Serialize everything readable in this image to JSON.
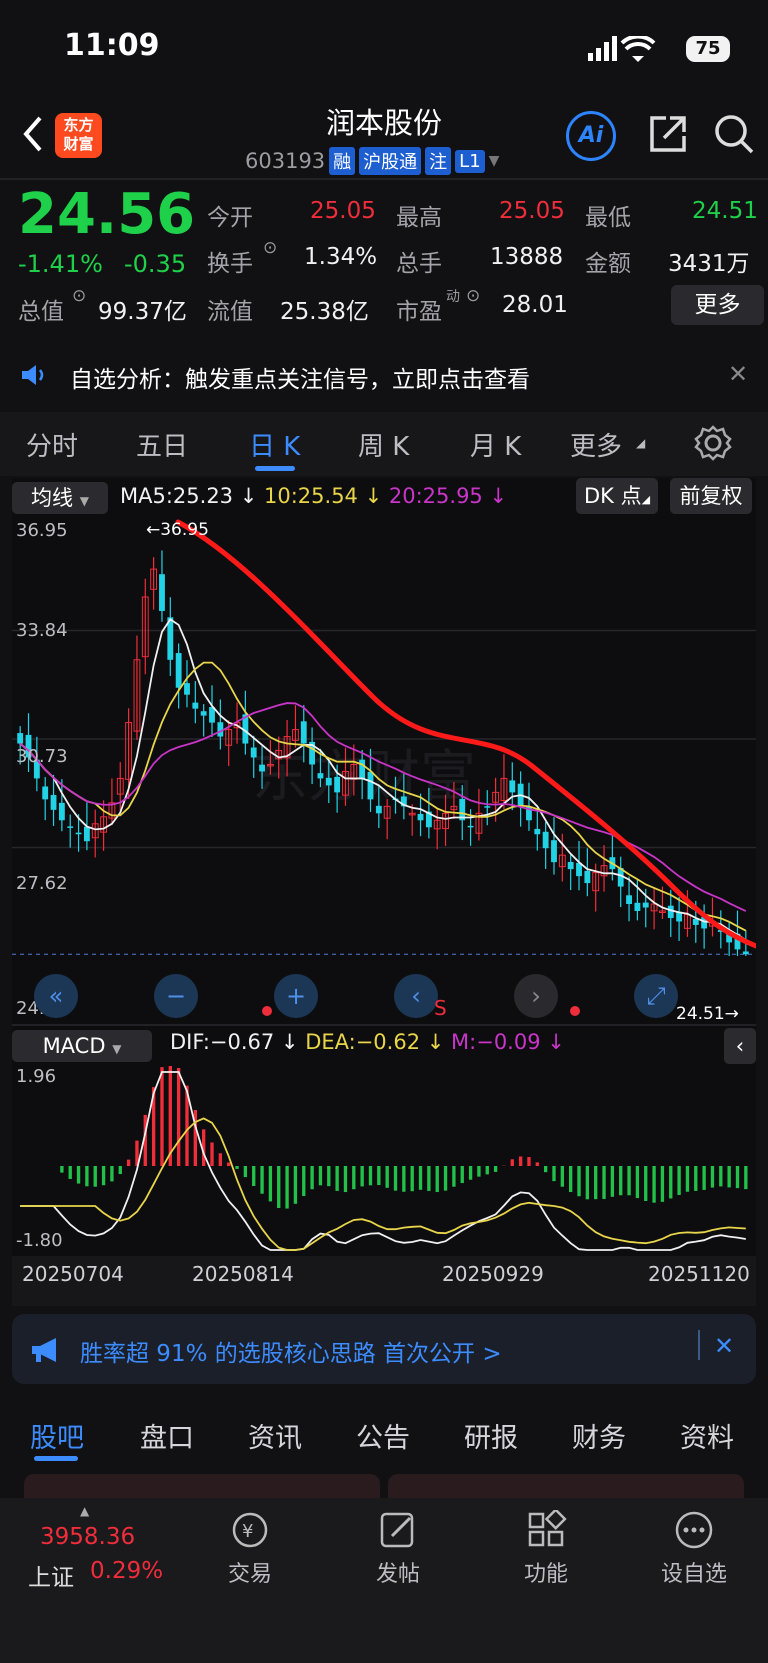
{
  "status": {
    "time": "11:09",
    "battery": "75"
  },
  "header": {
    "app_logo_top": "东方",
    "app_logo_bottom": "财富",
    "stock_name": "润本股份",
    "stock_code": "603193",
    "tags": [
      "融",
      "沪股通",
      "注",
      "L1"
    ],
    "ai_label": "Ai"
  },
  "quote": {
    "price": "24.56",
    "change_pct": "-1.41%",
    "change": "-0.35",
    "open_label": "今开",
    "open": "25.05",
    "high_label": "最高",
    "high": "25.05",
    "low_label": "最低",
    "low": "24.51",
    "turnover_label": "换手",
    "turnover": "1.34%",
    "volume_label": "总手",
    "volume": "13888",
    "amount_label": "金额",
    "amount": "3431万",
    "mcap_label": "总值",
    "mcap": "99.37亿",
    "float_label": "流值",
    "float": "25.38亿",
    "pe_label": "市盈",
    "pe_sup": "动",
    "pe": "28.01",
    "more_label": "更多"
  },
  "notice": {
    "text": "自选分析：触发重点关注信号，立即点击查看"
  },
  "period_tabs": [
    "分时",
    "五日",
    "日 K",
    "周 K",
    "月 K",
    "更多"
  ],
  "chart": {
    "indicator_select": "均线",
    "ma5": "MA5:25.23",
    "ma10": "10:25.54",
    "ma20": "20:25.95",
    "dk_label": "DK 点",
    "adjust_label": "前复权",
    "y_labels": [
      "36.95",
      "33.84",
      "30.73",
      "27.62",
      "24.51"
    ],
    "max_marker": "←36.95",
    "min_marker": "24.51→",
    "watermark": "东方财富",
    "s_marker": "S",
    "macd_select": "MACD",
    "dif": "DIF:−0.67",
    "dea": "DEA:−0.62",
    "m": "M:−0.09",
    "macd_y_top": "1.96",
    "macd_y_bottom": "-1.80",
    "dates": [
      "20250704",
      "20250814",
      "20250929",
      "20251120"
    ],
    "colors": {
      "up": "#f02d3a",
      "down": "#22d3e6",
      "ma5": "#f0f0f0",
      "ma10": "#e8d54a",
      "ma20": "#c935c8",
      "trend": "#ff1a1a"
    }
  },
  "ad": {
    "text": "胜率超 91% 的选股核心思路 首次公开 >"
  },
  "bottom_tabs": [
    "股吧",
    "盘口",
    "资讯",
    "公告",
    "研报",
    "财务",
    "资料"
  ],
  "bottom_bar": {
    "index_value": "3958.36",
    "index_name": "上证",
    "index_pct": "0.29%",
    "trade": "交易",
    "post": "发帖",
    "func": "功能",
    "watch": "设自选"
  },
  "chart_data": {
    "type": "candlestick",
    "ylim": [
      24.51,
      36.95
    ],
    "max": 36.95,
    "min": 24.51,
    "closes": [
      30.6,
      30.2,
      29.6,
      29.0,
      28.7,
      28.4,
      28.2,
      28.0,
      27.8,
      28.3,
      28.5,
      28.9,
      29.6,
      31.2,
      33.0,
      34.8,
      35.6,
      34.4,
      33.0,
      32.2,
      32.0,
      31.6,
      31.4,
      31.2,
      30.8,
      31.0,
      31.2,
      30.6,
      30.2,
      29.8,
      30.0,
      30.4,
      30.8,
      31.0,
      30.6,
      30.0,
      29.6,
      29.4,
      29.2,
      29.8,
      30.0,
      29.6,
      29.0,
      28.6,
      28.8,
      29.0,
      28.8,
      28.6,
      28.4,
      28.2,
      28.4,
      28.6,
      28.8,
      28.4,
      28.2,
      28.6,
      28.8,
      29.2,
      29.6,
      29.2,
      28.8,
      28.4,
      28.0,
      27.6,
      27.2,
      27.4,
      27.0,
      26.8,
      26.6,
      26.9,
      27.1,
      27.0,
      26.5,
      26.0,
      25.8,
      25.9,
      26.0,
      25.8,
      25.6,
      25.5,
      25.7,
      25.4,
      25.3,
      25.5,
      25.2,
      24.9,
      24.7,
      24.56
    ]
  }
}
